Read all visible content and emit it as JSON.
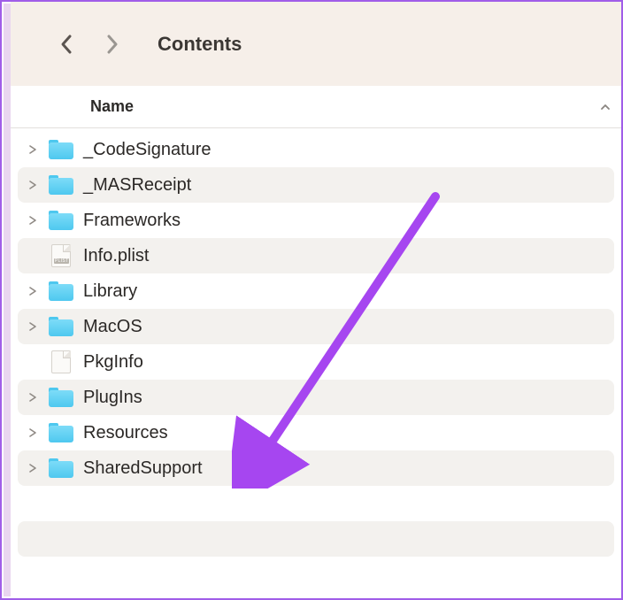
{
  "toolbar": {
    "title": "Contents"
  },
  "header": {
    "name_label": "Name"
  },
  "items": [
    {
      "name": "_CodeSignature",
      "type": "folder",
      "expandable": true
    },
    {
      "name": "_MASReceipt",
      "type": "folder",
      "expandable": true
    },
    {
      "name": "Frameworks",
      "type": "folder",
      "expandable": true
    },
    {
      "name": "Info.plist",
      "type": "plist",
      "expandable": false
    },
    {
      "name": "Library",
      "type": "folder",
      "expandable": true
    },
    {
      "name": "MacOS",
      "type": "folder",
      "expandable": true
    },
    {
      "name": "PkgInfo",
      "type": "file",
      "expandable": false
    },
    {
      "name": "PlugIns",
      "type": "folder",
      "expandable": true
    },
    {
      "name": "Resources",
      "type": "folder",
      "expandable": true
    },
    {
      "name": "SharedSupport",
      "type": "folder",
      "expandable": true
    }
  ],
  "annotation": {
    "arrow_color": "#a646f0"
  },
  "icons": {
    "plist_badge": "PLIST"
  }
}
